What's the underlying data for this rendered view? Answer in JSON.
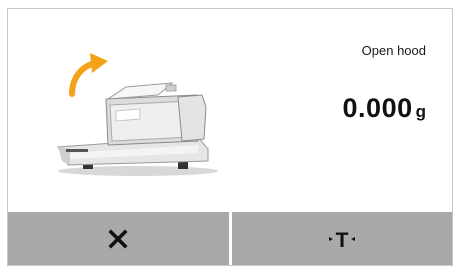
{
  "status": {
    "message": "Open hood"
  },
  "reading": {
    "value": "0.000",
    "unit": "g"
  },
  "softkeys": [
    {
      "icon": "close-icon",
      "glyph": "✕"
    },
    {
      "icon": "tare-icon",
      "label": "T"
    }
  ],
  "colors": {
    "softkey_bg": "#a9a9a9",
    "arrow": "#f5a21b",
    "text": "#111111"
  }
}
